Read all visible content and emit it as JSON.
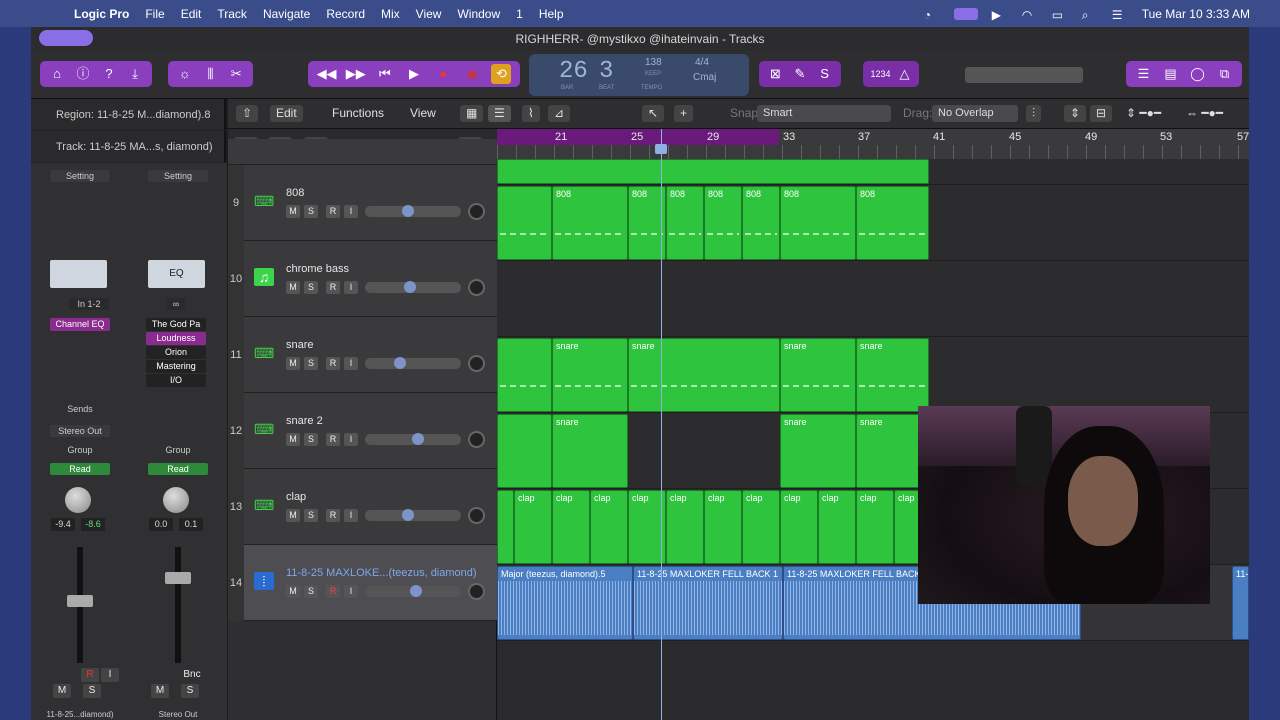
{
  "menubar": {
    "app": "Logic Pro",
    "items": [
      "File",
      "Edit",
      "Track",
      "Navigate",
      "Record",
      "Mix",
      "View",
      "Window",
      "1",
      "Help"
    ],
    "clock": "Tue Mar 10  3:33 AM"
  },
  "window": {
    "title": "RIGHHERR- @mystikxo @ihateinvain - Tracks"
  },
  "lcd": {
    "bar": "26",
    "beat": "3",
    "bar_label": "BAR",
    "beat_label": "BEAT",
    "tempo": "138",
    "keep": "KEEP",
    "tempo_label": "TEMPO",
    "time_sig": "4/4",
    "key": "Cmaj",
    "count_in": "1234"
  },
  "inspector": {
    "region": "Region: 11-8-25 M...diamond).8",
    "track": "Track:  11-8-25 MA...s, diamond)",
    "left_strip": {
      "setting": "Setting",
      "input": "In 1-2",
      "plugin": "Channel EQ",
      "sends": "Sends",
      "output": "Stereo Out",
      "group": "Group",
      "automation": "Read",
      "vol": "-9.4",
      "peak": "-8.6",
      "r": "R",
      "i": "I",
      "m": "M",
      "s": "S",
      "name": "11-8-25...diamond)"
    },
    "right_strip": {
      "setting": "Setting",
      "eq": "EQ",
      "plugins": [
        "The God Pa",
        "Loudness",
        "Orion",
        "Mastering",
        "I/O"
      ],
      "group": "Group",
      "automation": "Read",
      "vol": "0.0",
      "peak": "0.1",
      "bnc": "Bnc",
      "m": "M",
      "s": "S",
      "name": "Stereo Out"
    }
  },
  "toolbar": {
    "edit": "Edit",
    "functions": "Functions",
    "view": "View",
    "snap_label": "Snap:",
    "snap": "Smart",
    "drag_label": "Drag:",
    "drag": "No Overlap"
  },
  "tracks": [
    {
      "num": "9",
      "name": "808",
      "type": "midi",
      "m": "M",
      "s": "S",
      "r": "R",
      "i": "I"
    },
    {
      "num": "10",
      "name": "chrome bass",
      "type": "synth",
      "m": "M",
      "s": "S",
      "r": "R",
      "i": "I"
    },
    {
      "num": "11",
      "name": "snare",
      "type": "midi",
      "m": "M",
      "s": "S",
      "r": "R",
      "i": "I"
    },
    {
      "num": "12",
      "name": "snare 2",
      "type": "midi",
      "m": "M",
      "s": "S",
      "r": "R",
      "i": "I"
    },
    {
      "num": "13",
      "name": "clap",
      "type": "midi",
      "m": "M",
      "s": "S",
      "r": "R",
      "i": "I"
    },
    {
      "num": "14",
      "name": "11-8-25 MAXLOKE...(teezus, diamond)",
      "type": "audio",
      "m": "M",
      "s": "S",
      "r": "R",
      "i": "I"
    }
  ],
  "ruler": {
    "bars": [
      "21",
      "25",
      "29",
      "33",
      "37",
      "41",
      "45",
      "49",
      "53",
      "57"
    ]
  },
  "regions": {
    "row9": [
      "808",
      "808",
      "808",
      "808",
      "808",
      "808",
      "808"
    ],
    "row11": [
      "snare",
      "snare",
      "snare",
      "snare",
      "snare"
    ],
    "row12": [
      "snare",
      "snare",
      "snare",
      "snare"
    ],
    "row13": [
      "clap",
      "clap",
      "clap",
      "clap",
      "clap",
      "clap",
      "clap",
      "clap",
      "clap",
      "clap",
      "clap"
    ],
    "row14": [
      "Major (teezus, diamond).5",
      "11-8-25 MAXLOKER FELL BACK 1",
      "11-8-25 MAXLOKER FELL BACK",
      "11-"
    ]
  },
  "colors": {
    "midi_region": "#2ec43d",
    "audio_region": "#4a7fc4",
    "accent": "#8a3fbf"
  }
}
